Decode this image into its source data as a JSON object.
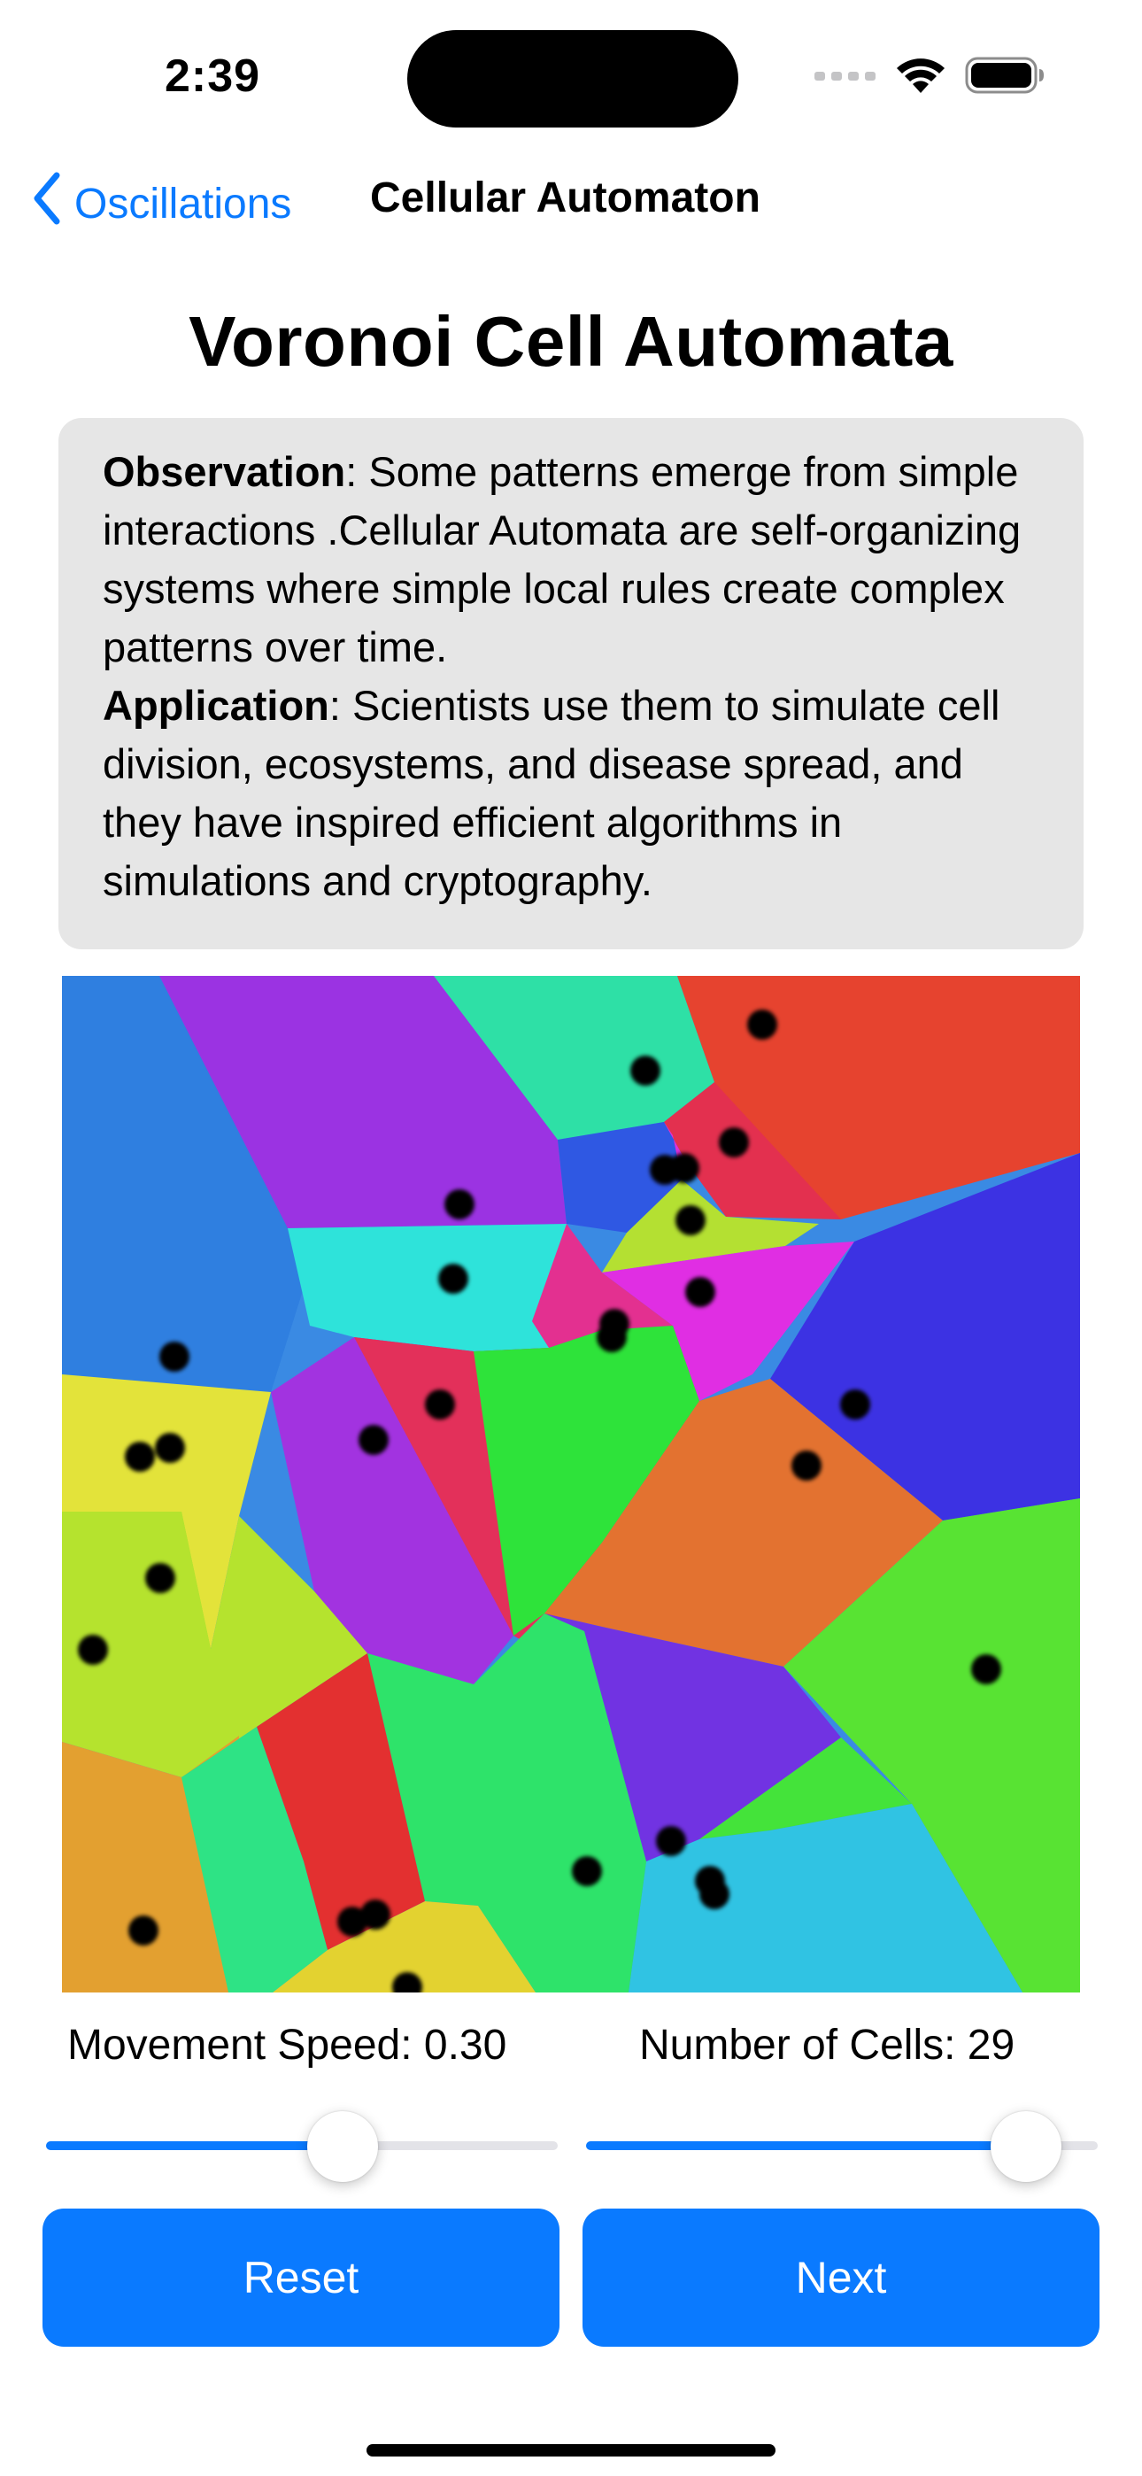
{
  "status_bar": {
    "time": "2:39"
  },
  "nav": {
    "back_label": "Oscillations",
    "title": "Cellular Automaton"
  },
  "page": {
    "title": "Voronoi Cell Automata"
  },
  "info": {
    "observation_label": "Observation",
    "observation_text": ": Some patterns emerge from simple interactions .Cellular Automata are self-organizing systems where simple local rules create complex patterns over time.",
    "application_label": "Application",
    "application_text": ":  Scientists use them to simulate cell division, ecosystems, and disease spread, and they have inspired efficient algorithms in simulations and cryptography."
  },
  "controls": {
    "speed_label": "Movement Speed: 0.30",
    "speed_value": 0.3,
    "speed_fraction": 0.58,
    "cells_label": "Number of Cells: 29",
    "cells_value": 29,
    "cells_fraction": 0.86,
    "reset_label": "Reset",
    "next_label": "Next"
  },
  "colors": {
    "accent": "#0a7aff",
    "card_background": "#e6e6e6"
  }
}
